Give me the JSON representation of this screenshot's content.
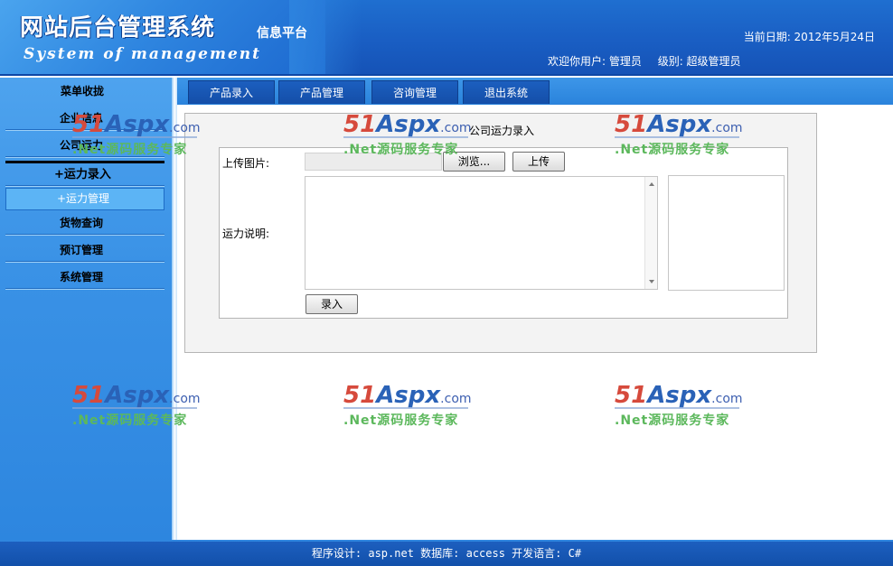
{
  "header": {
    "logo_cn": "网站后台管理系统",
    "logo_en": "System of management",
    "tagline": "信息平台",
    "date_label": "当前日期: 2012年5月24日",
    "welcome_label": "欢迎你用户: 管理员",
    "level_label": "级别: 超级管理员"
  },
  "sidebar": {
    "title": "菜单收拢",
    "items": [
      {
        "label": "企业信息"
      },
      {
        "label": "公司运力"
      },
      {
        "label": "+运力录入"
      },
      {
        "label": "+运力管理"
      },
      {
        "label": "货物查询"
      },
      {
        "label": "预订管理"
      },
      {
        "label": "系统管理"
      }
    ]
  },
  "tabs": [
    {
      "label": "产品录入"
    },
    {
      "label": "产品管理"
    },
    {
      "label": "咨询管理"
    },
    {
      "label": "退出系统"
    }
  ],
  "form": {
    "title": "公司运力录入",
    "upload_label": "上传图片:",
    "browse_button": "浏览...",
    "upload_button": "上传",
    "description_label": "运力说明:",
    "submit_button": "录入"
  },
  "watermark": {
    "num": "51",
    "brand": "Aspx",
    "com": ".com",
    "sub": ".Net源码服务专家"
  },
  "footer": {
    "text": "程序设计: asp.net 数据库: access 开发语言: C#"
  },
  "colors": {
    "header_blue": "#1a5fc4",
    "sidebar_blue": "#3a92e6",
    "tab_blue": "#144ea8"
  }
}
